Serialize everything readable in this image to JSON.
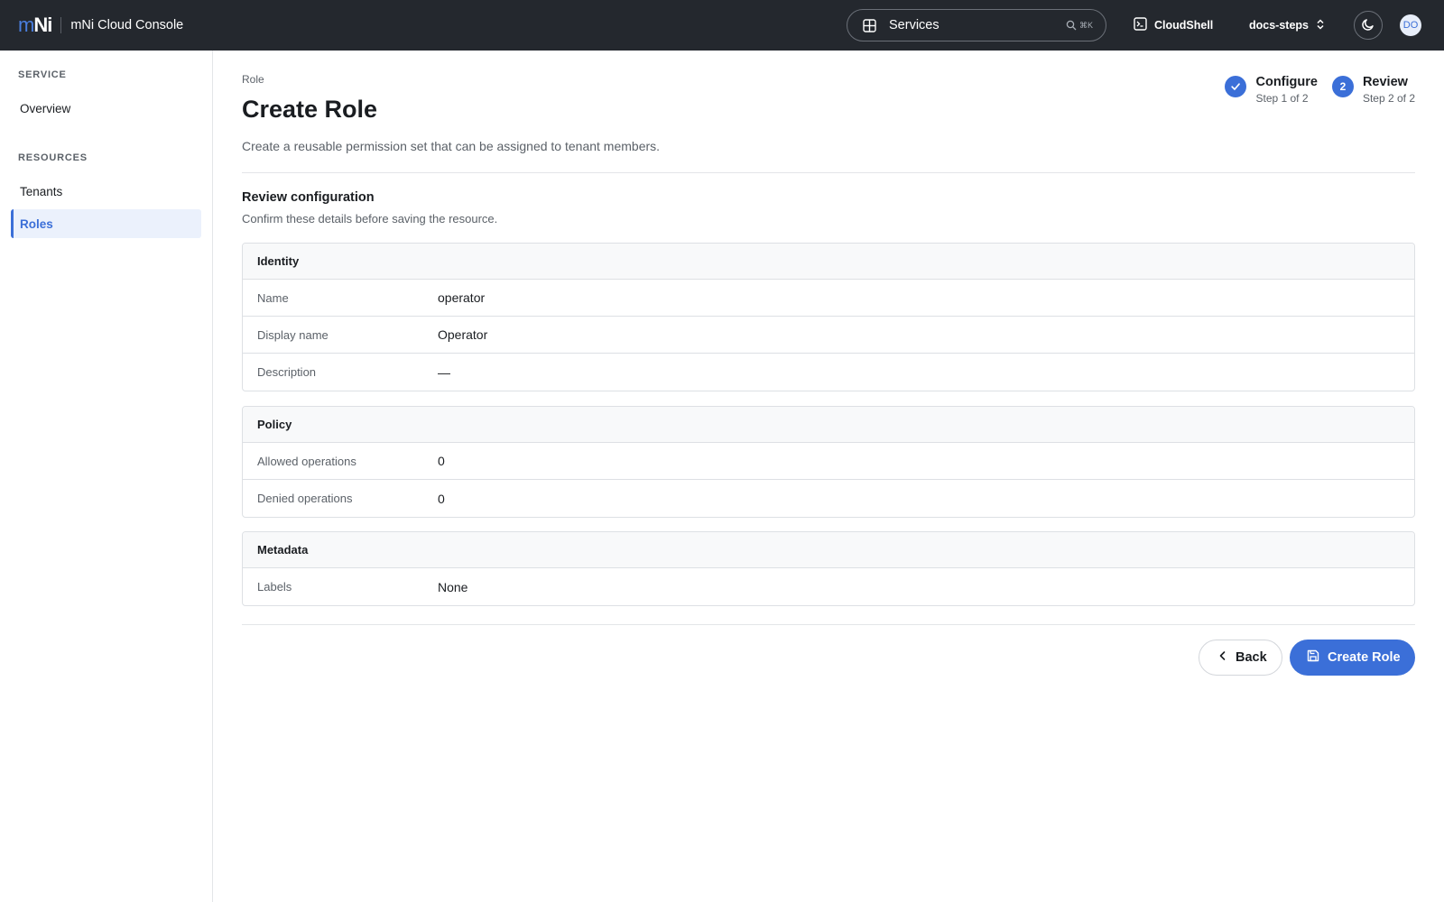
{
  "app": {
    "logo_m": "m",
    "logo_ni": "Ni",
    "title": "mNi Cloud Console"
  },
  "topbar": {
    "services_label": "Services",
    "services_shortcut": "⌘K",
    "cloudshell_label": "CloudShell",
    "project_label": "docs-steps",
    "avatar_initials": "DO"
  },
  "sidebar": {
    "sections": [
      {
        "heading": "SERVICE",
        "items": [
          {
            "label": "Overview",
            "active": false
          }
        ]
      },
      {
        "heading": "RESOURCES",
        "items": [
          {
            "label": "Tenants",
            "active": false
          },
          {
            "label": "Roles",
            "active": true
          }
        ]
      }
    ]
  },
  "page": {
    "breadcrumb": "Role",
    "title": "Create Role",
    "subtitle": "Create a reusable permission set that can be assigned to tenant members."
  },
  "stepper": [
    {
      "title": "Configure",
      "sub": "Step 1 of 2",
      "state": "complete"
    },
    {
      "title": "Review",
      "sub": "Step 2 of 2",
      "number": "2",
      "state": "current"
    }
  ],
  "review": {
    "title": "Review configuration",
    "subtitle": "Confirm these details before saving the resource."
  },
  "cards": [
    {
      "heading": "Identity",
      "rows": [
        {
          "key": "Name",
          "value": "operator"
        },
        {
          "key": "Display name",
          "value": "Operator"
        },
        {
          "key": "Description",
          "value": "—"
        }
      ]
    },
    {
      "heading": "Policy",
      "rows": [
        {
          "key": "Allowed operations",
          "value": "0"
        },
        {
          "key": "Denied operations",
          "value": "0"
        }
      ]
    },
    {
      "heading": "Metadata",
      "rows": [
        {
          "key": "Labels",
          "value": "None"
        }
      ]
    }
  ],
  "actions": {
    "back_label": "Back",
    "create_label": "Create Role"
  },
  "colors": {
    "accent": "#3b6fd8",
    "topbar": "#24282e"
  }
}
